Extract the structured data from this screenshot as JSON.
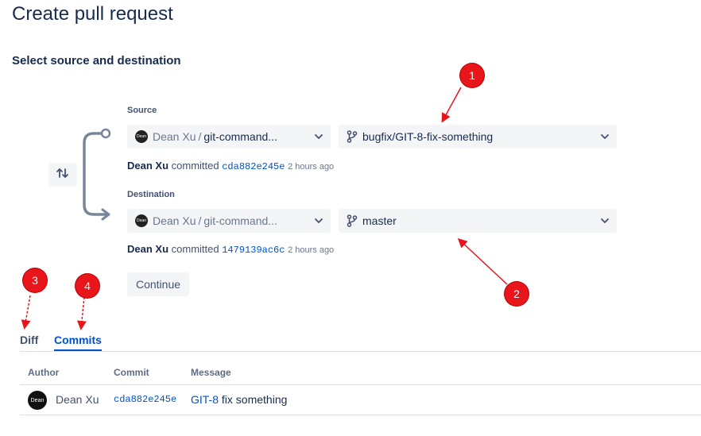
{
  "page": {
    "title": "Create pull request",
    "section_title": "Select source and destination"
  },
  "source": {
    "label": "Source",
    "repo_owner": "Dean Xu",
    "repo_sep": "/",
    "repo_name": "git-command...",
    "avatar_text": "Dean",
    "branch": "bugfix/GIT-8-fix-something",
    "commit": {
      "author": "Dean Xu",
      "verb": "committed",
      "hash": "cda882e245e",
      "time": "2 hours ago"
    }
  },
  "destination": {
    "label": "Destination",
    "repo_owner": "Dean Xu",
    "repo_sep": "/",
    "repo_name": "git-command...",
    "avatar_text": "Dean",
    "branch": "master",
    "commit": {
      "author": "Dean Xu",
      "verb": "committed",
      "hash": "1479139ac6c",
      "time": "2 hours ago"
    }
  },
  "actions": {
    "continue_label": "Continue",
    "swap_icon": "swap-arrows-icon"
  },
  "tabs": [
    {
      "label": "Diff",
      "active": false
    },
    {
      "label": "Commits",
      "active": true
    }
  ],
  "commits_table": {
    "headers": [
      "Author",
      "Commit",
      "Message"
    ],
    "rows": [
      {
        "avatar_text": "Dean",
        "author": "Dean Xu",
        "hash": "cda882e245e",
        "issue": "GIT-8",
        "message": "fix something"
      }
    ]
  },
  "annotations": [
    "1",
    "2",
    "3",
    "4"
  ],
  "colors": {
    "link": "#0052cc",
    "text": "#172b4d",
    "annotation": "#e8151b"
  }
}
